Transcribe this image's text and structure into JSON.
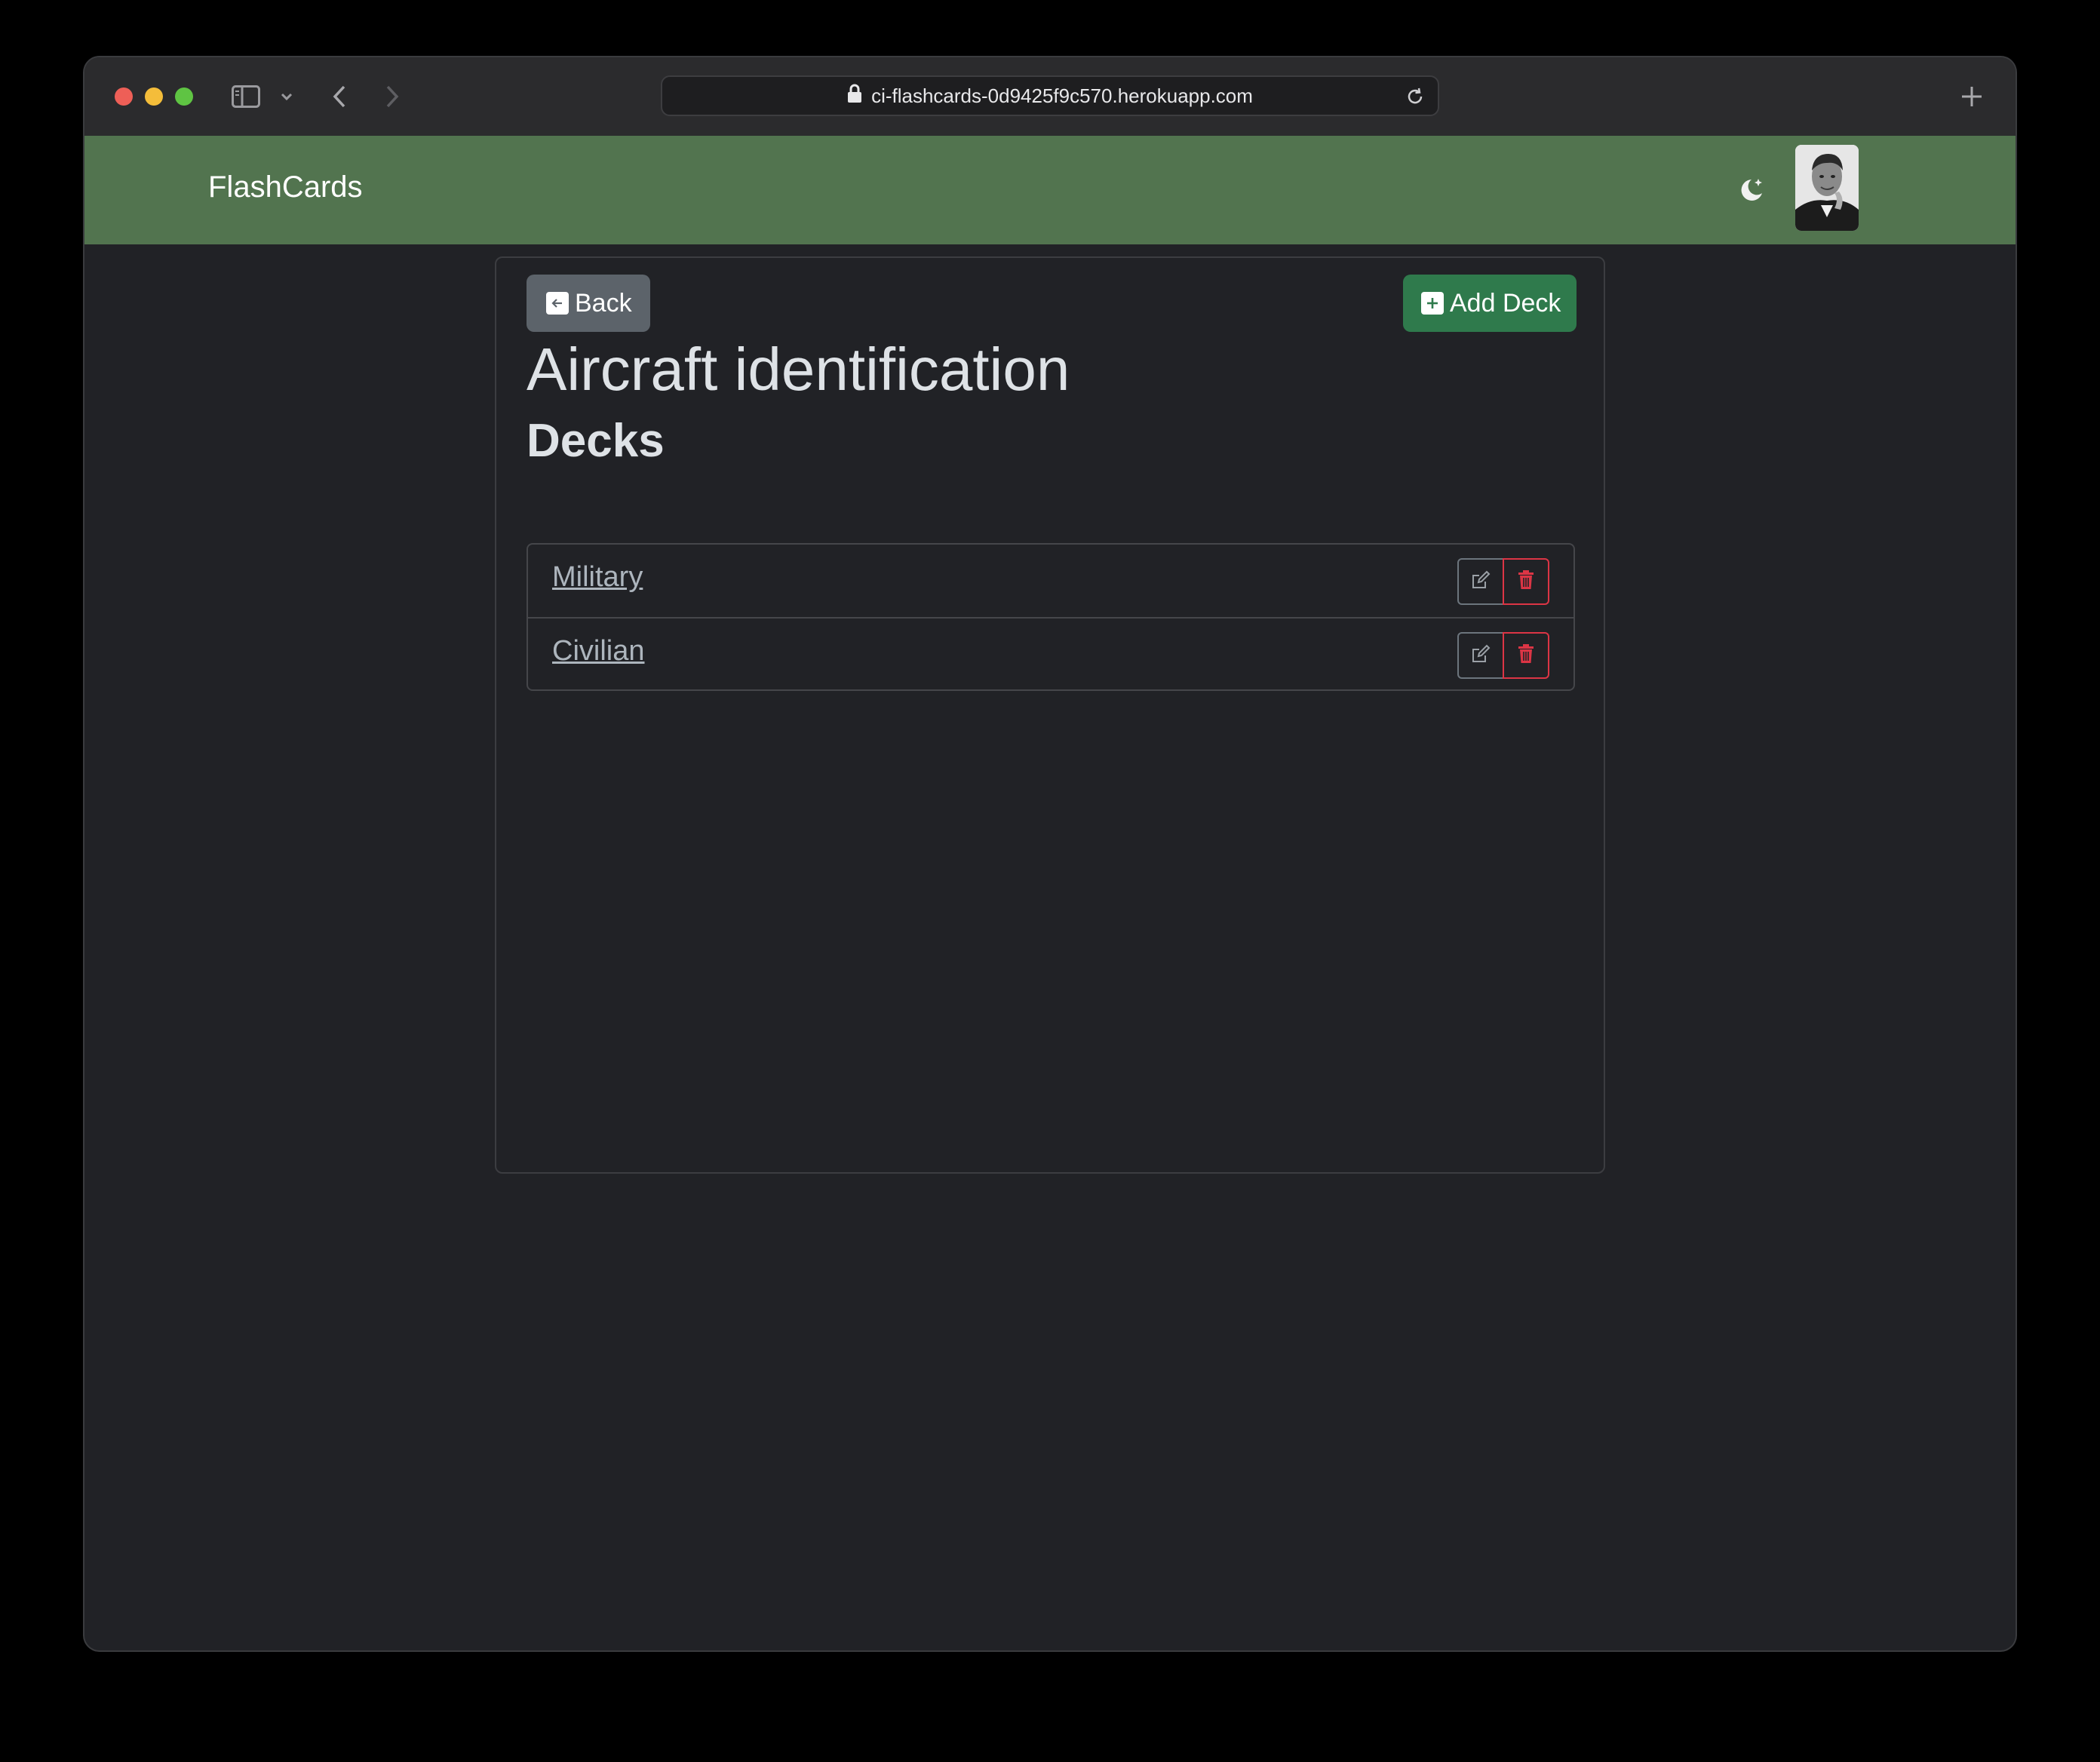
{
  "browser": {
    "url": "ci-flashcards-0d9425f9c570.herokuapp.com"
  },
  "navbar": {
    "brand": "FlashCards",
    "theme_icon": "moon-stars-icon",
    "avatar_icon": "profile-photo",
    "color": "#52744f"
  },
  "toolbar": {
    "back_label": "Back",
    "add_deck_label": "Add Deck"
  },
  "main": {
    "title": "Aircraft identification",
    "section": "Decks",
    "decks": [
      {
        "name": "Military"
      },
      {
        "name": "Civilian"
      }
    ]
  },
  "colors": {
    "background": "#212226",
    "success": "#2f7a4c",
    "secondary": "#5c636a",
    "danger": "#dc3545"
  }
}
